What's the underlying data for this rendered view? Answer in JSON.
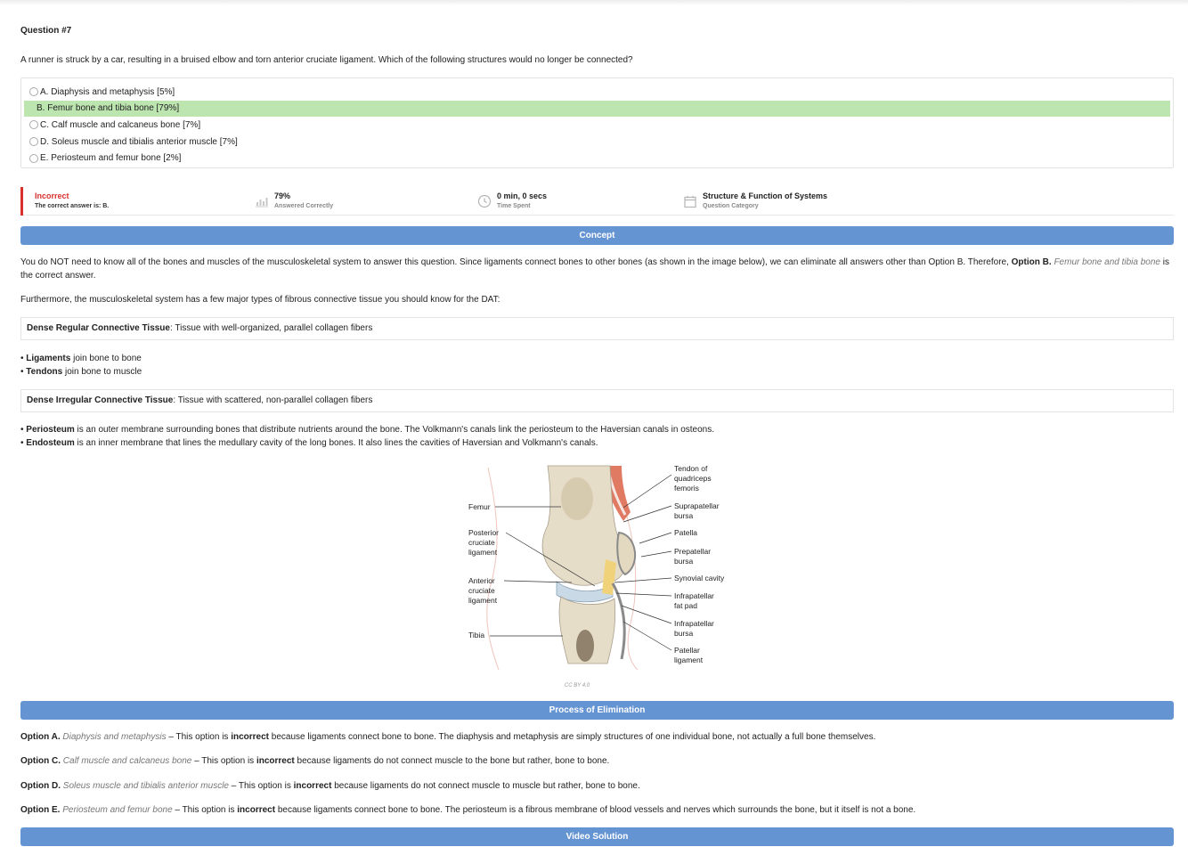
{
  "question": {
    "title": "Question #7",
    "text": "A runner is struck by a car, resulting in a bruised elbow and torn anterior cruciate ligament. Which of the following structures would no longer be connected?",
    "options": [
      {
        "label": "A. Diaphysis and metaphysis [5%]",
        "correct": false
      },
      {
        "label": "B. Femur bone and tibia bone [79%]",
        "correct": true
      },
      {
        "label": "C. Calf muscle and calcaneus bone [7%]",
        "correct": false
      },
      {
        "label": "D. Soleus muscle and tibialis anterior muscle [7%]",
        "correct": false
      },
      {
        "label": "E. Periosteum and femur bone [2%]",
        "correct": false
      }
    ]
  },
  "stats": {
    "result": "Incorrect",
    "result_sub": "The correct answer is: B.",
    "answered_value": "79%",
    "answered_label": "Answered Correctly",
    "answered_icon": "bar-chart-icon",
    "time_value": "0 min, 0 secs",
    "time_label": "Time Spent",
    "time_icon": "clock-icon",
    "category_value": "Structure & Function of Systems",
    "category_label": "Question Category",
    "category_icon": "calendar-icon"
  },
  "concept": {
    "header": "Concept",
    "p1_a": "You do NOT need to know all of the bones and muscles of the musculoskeletal system to answer this question. Since ligaments connect bones to other bones (as shown in the image below), we can eliminate all answers other than Option B. Therefore, ",
    "p1_bold": "Option B.",
    "p1_em": "Femur bone and tibia bone",
    "p1_b": " is the correct answer.",
    "p2": "Furthermore, the musculoskeletal system has a few major types of fibrous connective tissue you should know for the DAT:",
    "box1_bold": "Dense Regular Connective Tissue",
    "box1_rest": ": Tissue with well-organized, parallel collagen fibers",
    "b1_bold": "Ligaments",
    "b1_rest": " join bone to bone",
    "b2_bold": "Tendons",
    "b2_rest": " join bone to muscle",
    "box2_bold": "Dense Irregular Connective Tissue",
    "box2_rest": ": Tissue with scattered, non-parallel collagen fibers",
    "b3_bold": "Periosteum",
    "b3_rest": " is an outer membrane surrounding bones that distribute nutrients around the bone. The Volkmann's canals link the periosteum to the Haversian canals in osteons.",
    "b4_bold": "Endosteum",
    "b4_rest": " is an inner membrane that lines the medullary cavity of the long bones. It also lines the cavities of Haversian and Volkmann's canals.",
    "bullet": "•"
  },
  "figure": {
    "left_labels": [
      "Femur",
      "Posterior",
      "cruciate",
      "ligament",
      "Anterior",
      "cruciate",
      "ligament",
      "Tibia"
    ],
    "right_labels": [
      "Tendon of",
      "quadriceps",
      "femoris",
      "Suprapatellar",
      "bursa",
      "Patella",
      "Prepatellar",
      "bursa",
      "Synovial cavity",
      "Infrapatellar",
      "fat pad",
      "Infrapatellar",
      "bursa",
      "Patellar",
      "ligament"
    ],
    "license": "CC BY 4.0"
  },
  "elimination": {
    "header": "Process of Elimination",
    "items": [
      {
        "opt": "Option A.",
        "name": "Diaphysis and metaphysis",
        "dash": " – This option is ",
        "verdict": "incorrect",
        "reason": " because ligaments connect bone to bone. The diaphysis and metaphysis are simply structures of one individual bone, not actually a full bone themselves."
      },
      {
        "opt": "Option C.",
        "name": "Calf muscle and calcaneus bone",
        "dash": " – This option is ",
        "verdict": "incorrect",
        "reason": " because ligaments do not connect muscle to the bone but rather, bone to bone."
      },
      {
        "opt": "Option D.",
        "name": "Soleus muscle and tibialis anterior muscle",
        "dash": " – This option is ",
        "verdict": "incorrect",
        "reason": " because ligaments do not connect muscle to muscle but rather, bone to bone."
      },
      {
        "opt": "Option E.",
        "name": "Periosteum and femur bone",
        "dash": " – This option is ",
        "verdict": "incorrect",
        "reason": " because ligaments connect bone to bone. The periosteum is a fibrous membrane of blood vessels and nerves which surrounds the bone, but it itself is not a bone."
      }
    ]
  },
  "video": {
    "header": "Video Solution"
  }
}
